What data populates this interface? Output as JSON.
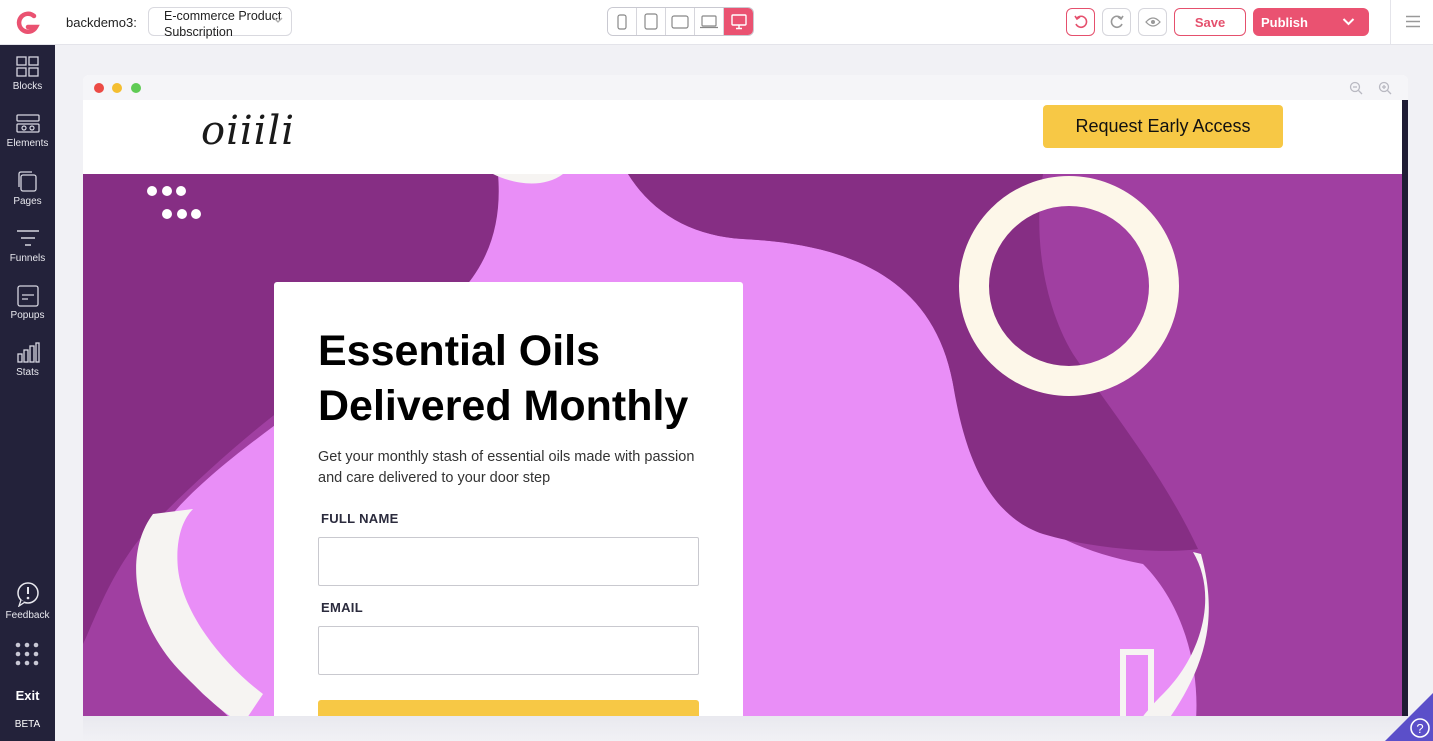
{
  "topbar": {
    "account_label": "backdemo3:",
    "page_select_line1": "E-commerce Product",
    "page_select_line2": "Subscription",
    "save_label": "Save",
    "publish_label": "Publish",
    "accent_color": "#ea5271"
  },
  "sidebar": {
    "items": [
      {
        "label": "Blocks",
        "icon": "blocks-icon"
      },
      {
        "label": "Elements",
        "icon": "elements-icon"
      },
      {
        "label": "Pages",
        "icon": "pages-icon"
      },
      {
        "label": "Funnels",
        "icon": "funnels-icon"
      },
      {
        "label": "Popups",
        "icon": "popups-icon"
      },
      {
        "label": "Stats",
        "icon": "stats-icon"
      }
    ],
    "feedback_label": "Feedback",
    "exit_label": "Exit",
    "beta_label": "BETA"
  },
  "site": {
    "brand": "oiiili",
    "cta_label": "Request Early Access",
    "headline": "Essential Oils Delivered Monthly",
    "description": "Get your monthly stash of essential oils made with passion and care delivered to your door step",
    "full_name_label": "FULL NAME",
    "email_label": "EMAIL",
    "cta_color": "#f7c845",
    "hero_color": "#a03fa1"
  }
}
